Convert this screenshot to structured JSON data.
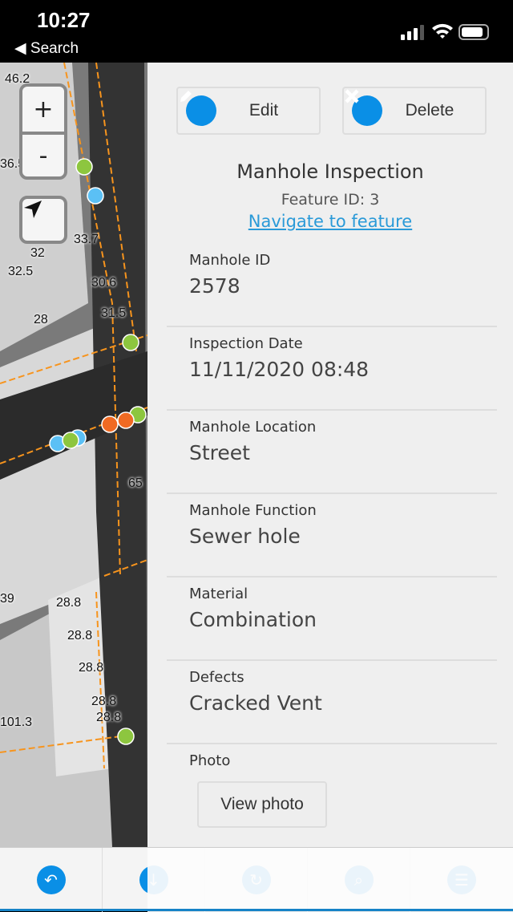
{
  "status_bar": {
    "time": "10:27",
    "back_label": "◀ Search"
  },
  "map": {
    "labels": [
      "46.2",
      "36.5",
      "33.7",
      "32",
      "32.5",
      "30.6",
      "28",
      "31.5",
      "65",
      "39",
      "28.8",
      "28.8",
      "28.8",
      "28.8",
      "28.8",
      "101.3"
    ],
    "zoom_in": "+",
    "zoom_out": "-"
  },
  "panel": {
    "edit_label": "Edit",
    "delete_label": "Delete",
    "title": "Manhole Inspection",
    "feature_id": "Feature ID: 3",
    "navigate_link": "Navigate to feature",
    "fields": [
      {
        "label": "Manhole ID",
        "value": "2578"
      },
      {
        "label": "Inspection Date",
        "value": "11/11/2020 08:48"
      },
      {
        "label": "Manhole Location",
        "value": "Street"
      },
      {
        "label": "Manhole Function",
        "value": "Sewer hole"
      },
      {
        "label": "Material",
        "value": "Combination"
      },
      {
        "label": "Defects",
        "value": "Cracked Vent"
      }
    ],
    "photo_label": "Photo",
    "photo_button": "View photo"
  },
  "toolbar": {
    "icons": [
      "undo-icon",
      "download-icon",
      "refresh-icon",
      "search-icon",
      "list-icon"
    ]
  },
  "colors": {
    "accent": "#0a8fe6",
    "link": "#2a9ad8",
    "point_green": "#8dc63f",
    "point_blue": "#5bc0f5",
    "point_orange": "#f06a23",
    "line_orange": "#f7941d"
  }
}
